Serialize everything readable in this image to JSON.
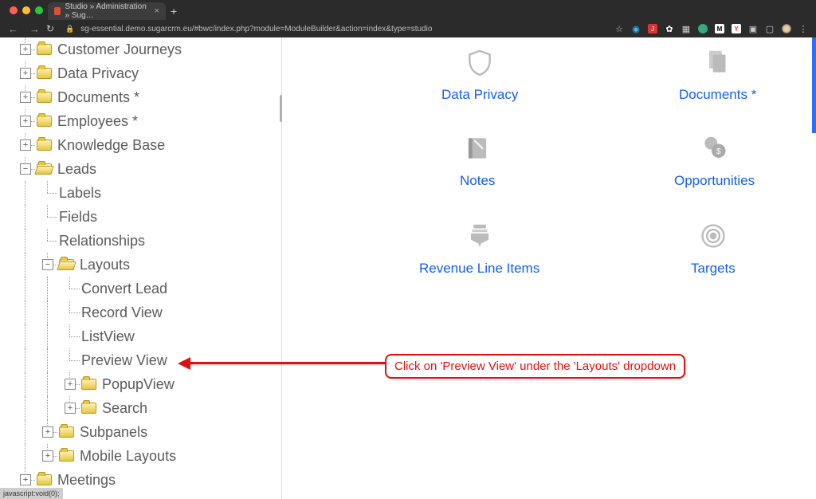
{
  "browser": {
    "tab_title": "Studio » Administration » Sug…",
    "url": "sg-essential.demo.sugarcrm.eu/#bwc/index.php?module=ModuleBuilder&action=index&type=studio",
    "new_tab_glyph": "+",
    "back_glyph": "←",
    "fwd_glyph": "→",
    "reload_glyph": "↻",
    "lock_glyph": "🔒",
    "star_glyph": "☆",
    "close_glyph": "×",
    "menu_glyph": "⋮"
  },
  "tree": {
    "customer_journeys": "Customer Journeys",
    "data_privacy": "Data Privacy",
    "documents": "Documents *",
    "employees": "Employees *",
    "knowledge_base": "Knowledge Base",
    "leads": "Leads",
    "labels": "Labels",
    "fields": "Fields",
    "relationships": "Relationships",
    "layouts": "Layouts",
    "convert_lead": "Convert Lead",
    "record_view": "Record View",
    "list_view": "ListView",
    "preview_view": "Preview View",
    "popup_view": "PopupView",
    "search": "Search",
    "subpanels": "Subpanels",
    "mobile_layouts": "Mobile Layouts",
    "meetings": "Meetings",
    "plus": "+",
    "minus": "−"
  },
  "content": {
    "data_privacy": "Data Privacy",
    "documents": "Documents *",
    "notes": "Notes",
    "opportunities": "Opportunities",
    "revenue_line_items": "Revenue Line Items",
    "targets": "Targets"
  },
  "annotation": {
    "text": "Click on 'Preview View' under the 'Layouts' dropdown"
  },
  "status_text": "javascript:void(0);"
}
